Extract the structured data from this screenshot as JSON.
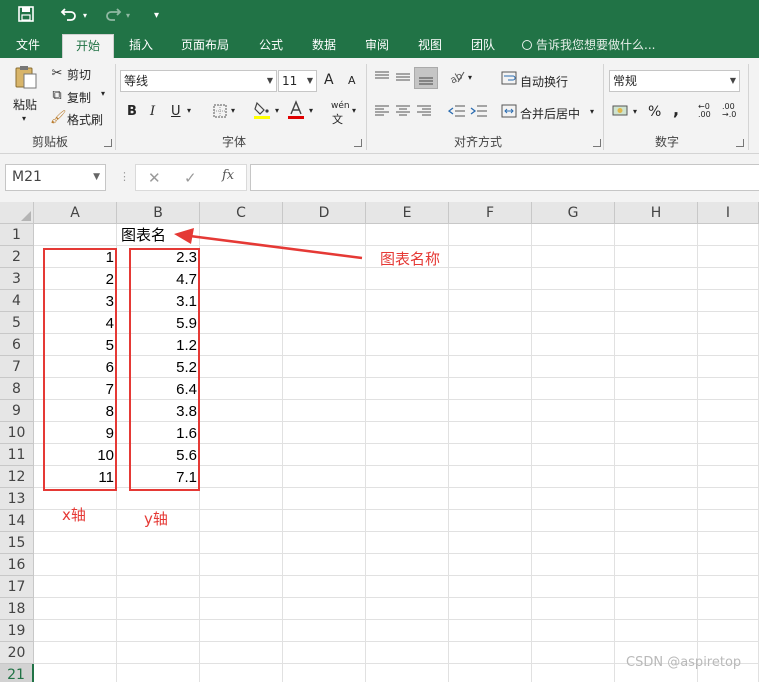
{
  "quick_access": {
    "save_icon": "save-icon",
    "undo_icon": "undo-icon",
    "redo_icon": "redo-icon",
    "customize_icon": "customize-quick-access-icon"
  },
  "tabs": [
    {
      "label": "文件"
    },
    {
      "label": "开始",
      "active": true
    },
    {
      "label": "插入"
    },
    {
      "label": "页面布局"
    },
    {
      "label": "公式"
    },
    {
      "label": "数据"
    },
    {
      "label": "审阅"
    },
    {
      "label": "视图"
    },
    {
      "label": "团队"
    }
  ],
  "tell_me": "告诉我您想要做什么...",
  "ribbon": {
    "clipboard": {
      "paste": "粘贴",
      "cut": "剪切",
      "copy": "复制",
      "format_painter": "格式刷",
      "group_label": "剪贴板"
    },
    "font": {
      "font_name": "等线",
      "font_size": "11",
      "bold": "B",
      "italic": "I",
      "underline": "U",
      "group_label": "字体",
      "grow": "A",
      "shrink": "A",
      "wen": "wén"
    },
    "alignment": {
      "wrap_text": "自动换行",
      "merge_center": "合并后居中",
      "group_label": "对齐方式"
    },
    "number": {
      "format": "常规",
      "percent": "%",
      "comma": ",",
      "group_label": "数字"
    }
  },
  "formula_bar": {
    "name_box": "M21",
    "fx": "fx",
    "formula": ""
  },
  "columns": [
    "A",
    "B",
    "C",
    "D",
    "E",
    "F",
    "G",
    "H",
    "I"
  ],
  "rows": [
    "1",
    "2",
    "3",
    "4",
    "5",
    "6",
    "7",
    "8",
    "9",
    "10",
    "11",
    "12",
    "13",
    "14",
    "15",
    "16",
    "17",
    "18",
    "19",
    "20",
    "21"
  ],
  "selected_row": "21",
  "cells": {
    "B1": "图表名",
    "A": [
      "1",
      "2",
      "3",
      "4",
      "5",
      "6",
      "7",
      "8",
      "9",
      "10",
      "11"
    ],
    "B": [
      "2.3",
      "4.7",
      "3.1",
      "5.9",
      "1.2",
      "5.2",
      "6.4",
      "3.8",
      "1.6",
      "5.6",
      "7.1"
    ]
  },
  "annotations": {
    "chart_title": "图表名称",
    "x_axis": "x轴",
    "y_axis": "y轴"
  },
  "watermark": "CSDN @aspiretop",
  "colors": {
    "excel_green": "#217346",
    "annotation_red": "#e53935"
  }
}
